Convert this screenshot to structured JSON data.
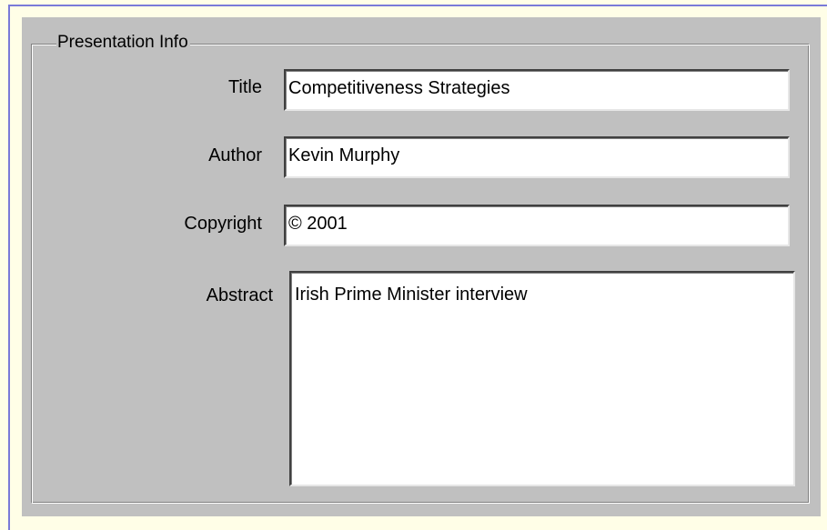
{
  "group": {
    "legend": "Presentation Info"
  },
  "fields": {
    "title": {
      "label": "Title",
      "value": "Competitiveness Strategies"
    },
    "author": {
      "label": "Author",
      "value": "Kevin Murphy"
    },
    "copyright": {
      "label": "Copyright",
      "value": "© 2001"
    },
    "abstract": {
      "label": "Abstract",
      "value": "Irish Prime Minister interview"
    }
  }
}
